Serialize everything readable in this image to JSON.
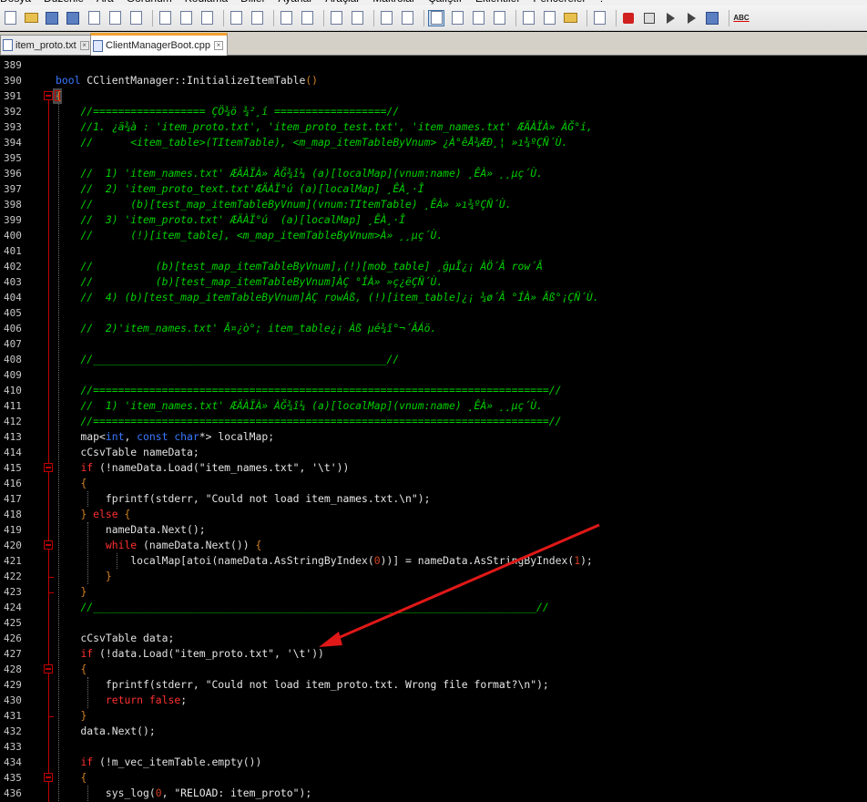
{
  "menu": [
    "Dosya",
    "Düzenle",
    "Ara",
    "Görünüm",
    "Kodlama",
    "Diller",
    "Ayarlar",
    "Araçlar",
    "Makrolar",
    "Çalıştır",
    "Eklentiler",
    "Pencereler",
    "?"
  ],
  "toolbar": {
    "icons": [
      "new-file-icon",
      "open-folder-icon",
      "save-icon",
      "save-all-icon",
      "close-icon",
      "close-all-icon",
      "print-icon",
      "cut-icon",
      "copy-icon",
      "paste-icon",
      "undo-icon",
      "redo-icon",
      "find-icon",
      "replace-icon",
      "zoom-in-icon",
      "zoom-out-icon",
      "sync-v-icon",
      "sync-h-icon",
      "word-wrap-icon",
      "show-all-chars-icon",
      "indent-guide-icon",
      "user-lang-icon",
      "doc-map-icon",
      "function-list-icon",
      "folder-workspace-icon",
      "monitor-icon",
      "record-macro-icon",
      "stop-record-icon",
      "play-macro-icon",
      "run-macro-icon",
      "save-macro-icon",
      "spell-check-icon"
    ],
    "spell_label": "ABC"
  },
  "tabs": [
    {
      "label": "item_proto.txt",
      "active": false
    },
    {
      "label": "ClientManagerBoot.cpp",
      "active": true
    }
  ],
  "lines": [
    {
      "n": "389",
      "t": []
    },
    {
      "n": "390",
      "t": [
        [
          "k",
          "bool"
        ],
        [
          "p",
          " CClientManager::InitializeItemTable"
        ],
        [
          "sc",
          "()"
        ]
      ]
    },
    {
      "n": "391",
      "t": [
        [
          "sc",
          "{"
        ]
      ]
    },
    {
      "n": "392",
      "t": [
        [
          "p",
          "    "
        ],
        [
          "c",
          "//================== ÇÖ¾ö ¾²¸í ==================//"
        ]
      ]
    },
    {
      "n": "393",
      "t": [
        [
          "p",
          "    "
        ],
        [
          "c",
          "//1. ¿ä¾à : 'item_proto.txt', 'item_proto_test.txt', 'item_names.txt' ÆÄÀÏÀ» ÀĞ°í,"
        ]
      ]
    },
    {
      "n": "394",
      "t": [
        [
          "p",
          "    "
        ],
        [
          "c",
          "//      <item_table>(TItemTable), <m_map_itemTableByVnum> ¿À°êÅ¾ÆÐ¸¦ »ı¾ºÇÑ´Ù."
        ]
      ]
    },
    {
      "n": "395",
      "t": []
    },
    {
      "n": "396",
      "t": [
        [
          "p",
          "    "
        ],
        [
          "c",
          "//  1) 'item_names.txt' ÆÄÀÏÀ» ÀĞ¾î¼­ (a)[localMap](vnum:name) ¸ÊÀ» ¸¸µç´Ù."
        ]
      ]
    },
    {
      "n": "397",
      "t": [
        [
          "p",
          "    "
        ],
        [
          "c",
          "//  2) 'item_proto_text.txt'ÆÄÀÏ°ú (a)[localMap] ¸ÊÀ¸·Î"
        ]
      ]
    },
    {
      "n": "398",
      "t": [
        [
          "p",
          "    "
        ],
        [
          "c",
          "//      (b)[test_map_itemTableByVnum](vnum:TItemTable) ¸ÊÀ» »ı¾ºÇÑ´Ù."
        ]
      ]
    },
    {
      "n": "399",
      "t": [
        [
          "p",
          "    "
        ],
        [
          "c",
          "//  3) 'item_proto.txt' ÆÄÀÏ°ú  (a)[localMap] ¸ÊÀ¸·Î"
        ]
      ]
    },
    {
      "n": "400",
      "t": [
        [
          "p",
          "    "
        ],
        [
          "c",
          "//      (!)[item_table], <m_map_itemTableByVnum>À» ¸¸µç´Ù."
        ]
      ]
    },
    {
      "n": "401",
      "t": []
    },
    {
      "n": "402",
      "t": [
        [
          "p",
          "    "
        ],
        [
          "c",
          "//          (b)[test_map_itemTableByVnum],(!)[mob_table] ¸ğµÎ¿¡ ÀÖ´Â row´Â"
        ]
      ]
    },
    {
      "n": "403",
      "t": [
        [
          "p",
          "    "
        ],
        [
          "c",
          "//          (b)[test_map_itemTableByVnum]ÀÇ °ÍÀ» »ç¿ëÇÑ´Ù."
        ]
      ]
    },
    {
      "n": "404",
      "t": [
        [
          "p",
          "    "
        ],
        [
          "c",
          "//  4) (b)[test_map_itemTableByVnum]ÀÇ rowÁß, (!)[item_table]¿¡ ¾ø´Â °ÍÀ» Ãß°¡ÇÑ´Ù."
        ]
      ]
    },
    {
      "n": "405",
      "t": []
    },
    {
      "n": "406",
      "t": [
        [
          "p",
          "    "
        ],
        [
          "c",
          "//  2)'item_names.txt' Ã¤¿ò°; item_table¿¡ Àß µé¾î°¬´ÂÁö."
        ]
      ]
    },
    {
      "n": "407",
      "t": []
    },
    {
      "n": "408",
      "t": [
        [
          "p",
          "    "
        ],
        [
          "c",
          "//_______________________________________________//"
        ]
      ]
    },
    {
      "n": "409",
      "t": []
    },
    {
      "n": "410",
      "t": [
        [
          "p",
          "    "
        ],
        [
          "c",
          "//=========================================================================//"
        ]
      ]
    },
    {
      "n": "411",
      "t": [
        [
          "p",
          "    "
        ],
        [
          "c",
          "//  1) 'item_names.txt' ÆÄÀÏÀ» ÀĞ¾î¼­ (a)[localMap](vnum:name) ¸ÊÀ» ¸¸µç´Ù."
        ]
      ]
    },
    {
      "n": "412",
      "t": [
        [
          "p",
          "    "
        ],
        [
          "c",
          "//=========================================================================//"
        ]
      ]
    },
    {
      "n": "413",
      "t": [
        [
          "p",
          "    map<"
        ],
        [
          "k",
          "int"
        ],
        [
          "p",
          ", "
        ],
        [
          "k",
          "const"
        ],
        [
          "p",
          " "
        ],
        [
          "k",
          "char"
        ],
        [
          "p",
          "*> localMap;"
        ]
      ]
    },
    {
      "n": "414",
      "t": [
        [
          "p",
          "    cCsvTable nameData;"
        ]
      ]
    },
    {
      "n": "415",
      "t": [
        [
          "p",
          "    "
        ],
        [
          "red",
          "if"
        ],
        [
          "p",
          " (!nameData.Load("
        ],
        [
          "s",
          "\"item_names.txt\""
        ],
        [
          "p",
          ", "
        ],
        [
          "s",
          "'\\t'"
        ],
        [
          "p",
          "))"
        ]
      ]
    },
    {
      "n": "416",
      "t": [
        [
          "p",
          "    "
        ],
        [
          "sc",
          "{"
        ]
      ]
    },
    {
      "n": "417",
      "t": [
        [
          "p",
          "        fprintf(stderr, "
        ],
        [
          "s",
          "\"Could not load item_names.txt.\\n\""
        ],
        [
          "p",
          ");"
        ]
      ]
    },
    {
      "n": "418",
      "t": [
        [
          "p",
          "    "
        ],
        [
          "sc",
          "}"
        ],
        [
          "p",
          " "
        ],
        [
          "red",
          "else"
        ],
        [
          "p",
          " "
        ],
        [
          "sc",
          "{"
        ]
      ]
    },
    {
      "n": "419",
      "t": [
        [
          "p",
          "        nameData.Next();"
        ]
      ]
    },
    {
      "n": "420",
      "t": [
        [
          "p",
          "        "
        ],
        [
          "red",
          "while"
        ],
        [
          "p",
          " (nameData.Next()) "
        ],
        [
          "sc",
          "{"
        ]
      ]
    },
    {
      "n": "421",
      "t": [
        [
          "p",
          "            localMap[atoi(nameData.AsStringByIndex("
        ],
        [
          "n",
          "0"
        ],
        [
          "p",
          "))] = nameData.AsStringByIndex("
        ],
        [
          "n",
          "1"
        ],
        [
          "p",
          ");"
        ]
      ]
    },
    {
      "n": "422",
      "t": [
        [
          "p",
          "        "
        ],
        [
          "sc",
          "}"
        ]
      ]
    },
    {
      "n": "423",
      "t": [
        [
          "p",
          "    "
        ],
        [
          "sc",
          "}"
        ]
      ]
    },
    {
      "n": "424",
      "t": [
        [
          "p",
          "    "
        ],
        [
          "c",
          "//_______________________________________________________________________//"
        ]
      ]
    },
    {
      "n": "425",
      "t": []
    },
    {
      "n": "426",
      "t": [
        [
          "p",
          "    cCsvTable data;"
        ]
      ]
    },
    {
      "n": "427",
      "t": [
        [
          "p",
          "    "
        ],
        [
          "red",
          "if"
        ],
        [
          "p",
          " (!data.Load("
        ],
        [
          "s",
          "\"item_proto.txt\""
        ],
        [
          "p",
          ", "
        ],
        [
          "s",
          "'\\t'"
        ],
        [
          "p",
          "))"
        ]
      ]
    },
    {
      "n": "428",
      "t": [
        [
          "p",
          "    "
        ],
        [
          "sc",
          "{"
        ]
      ]
    },
    {
      "n": "429",
      "t": [
        [
          "p",
          "        fprintf(stderr, "
        ],
        [
          "s",
          "\"Could not load item_proto.txt. Wrong file format?\\n\""
        ],
        [
          "p",
          ");"
        ]
      ]
    },
    {
      "n": "430",
      "t": [
        [
          "p",
          "        "
        ],
        [
          "red",
          "return"
        ],
        [
          "p",
          " "
        ],
        [
          "red",
          "false"
        ],
        [
          "p",
          ";"
        ]
      ]
    },
    {
      "n": "431",
      "t": [
        [
          "p",
          "    "
        ],
        [
          "sc",
          "}"
        ]
      ]
    },
    {
      "n": "432",
      "t": [
        [
          "p",
          "    data.Next();"
        ]
      ]
    },
    {
      "n": "433",
      "t": []
    },
    {
      "n": "434",
      "t": [
        [
          "p",
          "    "
        ],
        [
          "red",
          "if"
        ],
        [
          "p",
          " (!m_vec_itemTable.empty())"
        ]
      ]
    },
    {
      "n": "435",
      "t": [
        [
          "p",
          "    "
        ],
        [
          "sc",
          "{"
        ]
      ]
    },
    {
      "n": "436",
      "t": [
        [
          "p",
          "        sys_log("
        ],
        [
          "n",
          "0"
        ],
        [
          "p",
          ", "
        ],
        [
          "s",
          "\"RELOAD: item_proto\""
        ],
        [
          "p",
          ");"
        ]
      ]
    }
  ],
  "colors": {
    "comment": "#00d000",
    "keyword": "#3a78ff",
    "control": "#ff3030",
    "annotation_arrow": "#e01818"
  }
}
